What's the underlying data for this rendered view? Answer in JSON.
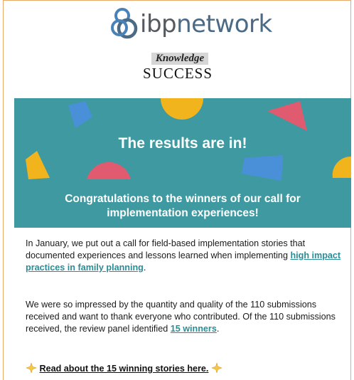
{
  "header": {
    "logo_ibp": "ibp",
    "logo_network": "network",
    "knowledge": "Knowledge",
    "success": "SUCCESS"
  },
  "banner": {
    "title": "The results are in!",
    "subtitle_line1": "Congratulations to the winners of our call for",
    "subtitle_line2": "implementation experiences!",
    "background_color": "#3e9aa0"
  },
  "body": {
    "p1_text": "In January, we put out a call for field-based implementation stories that documented experiences and lessons learned when implementing ",
    "p1_link": "high impact practices in family planning",
    "p1_end": ".",
    "p2_text": "We were so impressed by the quantity and quality of the 110 submissions received and want to thank everyone who contributed. Of the 110 submissions received, the review panel identified ",
    "p2_link": "15 winners",
    "p2_end": ".",
    "cta": "Read about the 15 winning stories here.",
    "link_color": "#2a8d96"
  },
  "icons": [
    "ibp-logo-icon",
    "sparkle-icon"
  ]
}
